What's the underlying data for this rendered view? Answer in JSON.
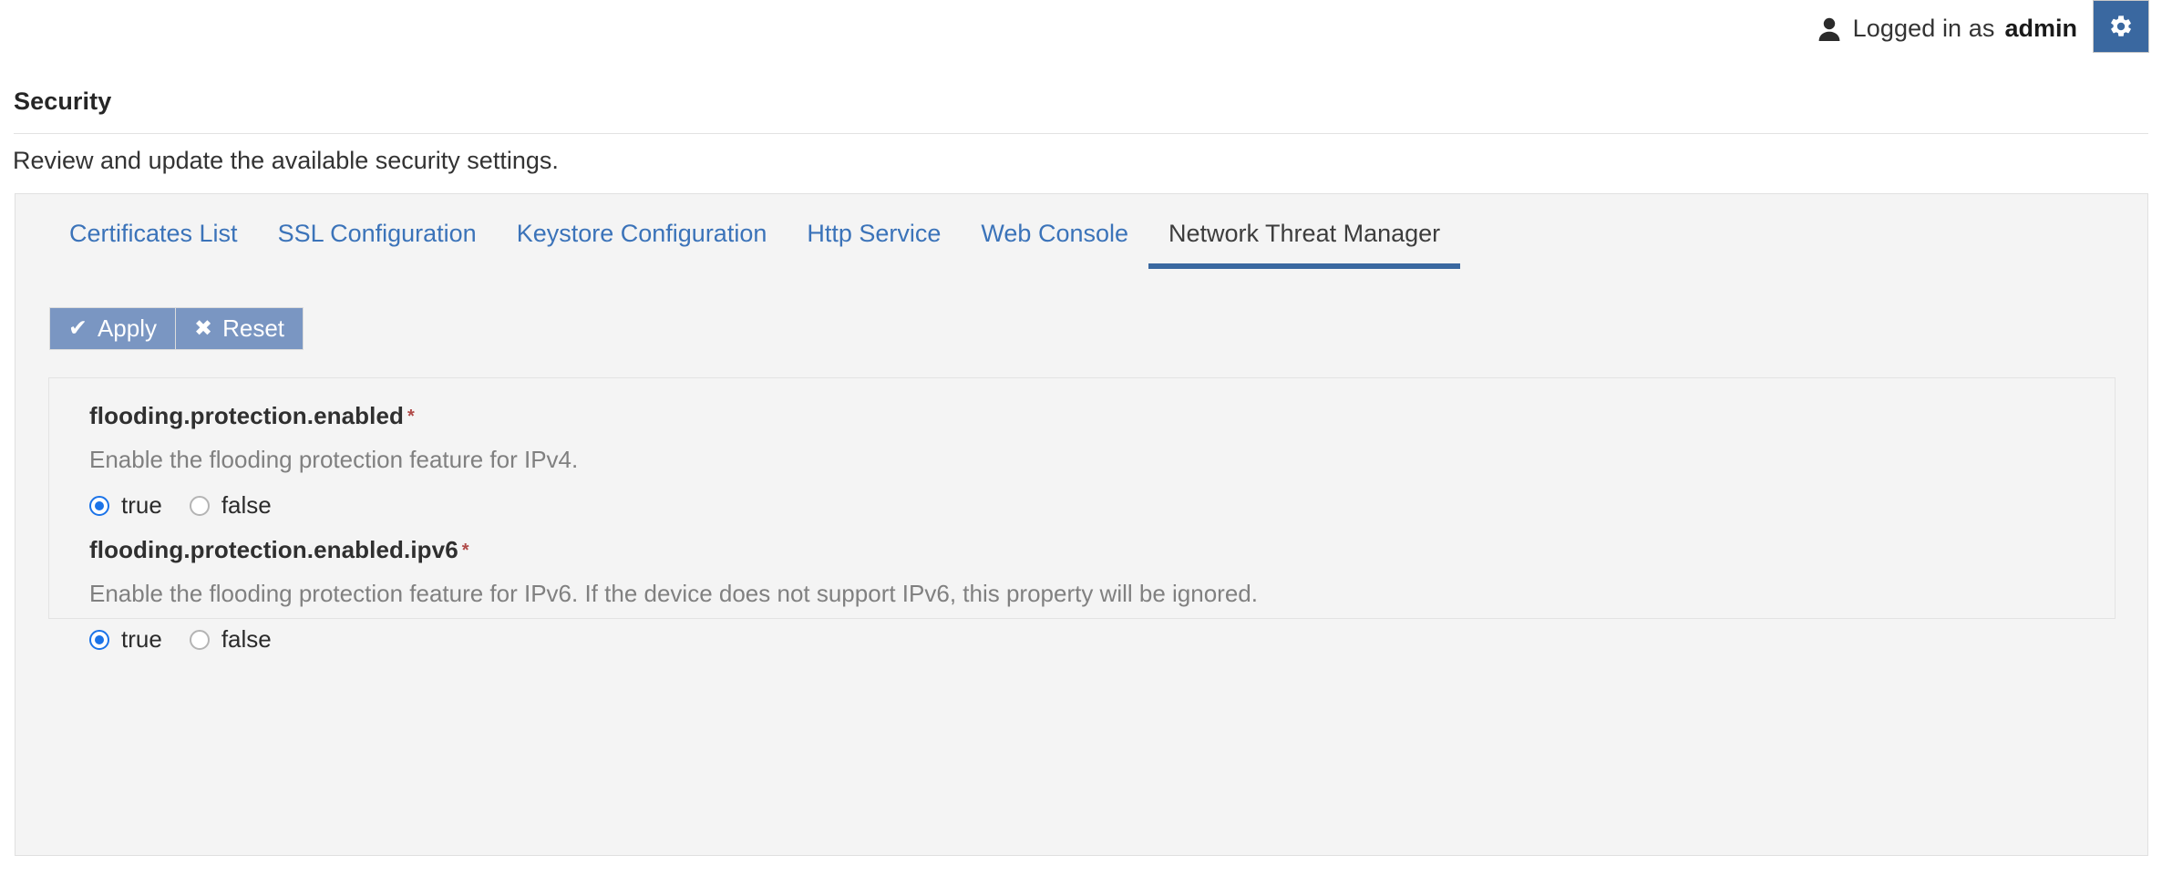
{
  "topbar": {
    "user_icon": "user-icon",
    "logged_in_text": "Logged in as",
    "username": "admin",
    "settings_icon": "gear-icon",
    "accent_color": "#3a68a0"
  },
  "page": {
    "title": "Security",
    "subtitle": "Review and update the available security settings."
  },
  "tabs": [
    {
      "label": "Certificates List",
      "active": false
    },
    {
      "label": "SSL Configuration",
      "active": false
    },
    {
      "label": "Keystore Configuration",
      "active": false
    },
    {
      "label": "Http Service",
      "active": false
    },
    {
      "label": "Web Console",
      "active": false
    },
    {
      "label": "Network Threat Manager",
      "active": true
    }
  ],
  "toolbar": {
    "apply_label": "Apply",
    "apply_icon": "check-icon",
    "reset_label": "Reset",
    "reset_icon": "close-icon",
    "button_color": "#7a96c2"
  },
  "properties": [
    {
      "name": "flooding.protection.enabled",
      "required_marker": "*",
      "description": "Enable the flooding protection feature for IPv4.",
      "options": [
        "true",
        "false"
      ],
      "value": "true"
    },
    {
      "name": "flooding.protection.enabled.ipv6",
      "required_marker": "*",
      "description": "Enable the flooding protection feature for IPv6. If the device does not support IPv6, this property will be ignored.",
      "options": [
        "true",
        "false"
      ],
      "value": "true"
    }
  ],
  "colors": {
    "tab_link": "#3b73b9",
    "tab_active_underline": "#3a68a0",
    "required_star": "#b04a48",
    "radio_selected": "#1b73e8",
    "panel_bg": "#f4f4f4"
  }
}
